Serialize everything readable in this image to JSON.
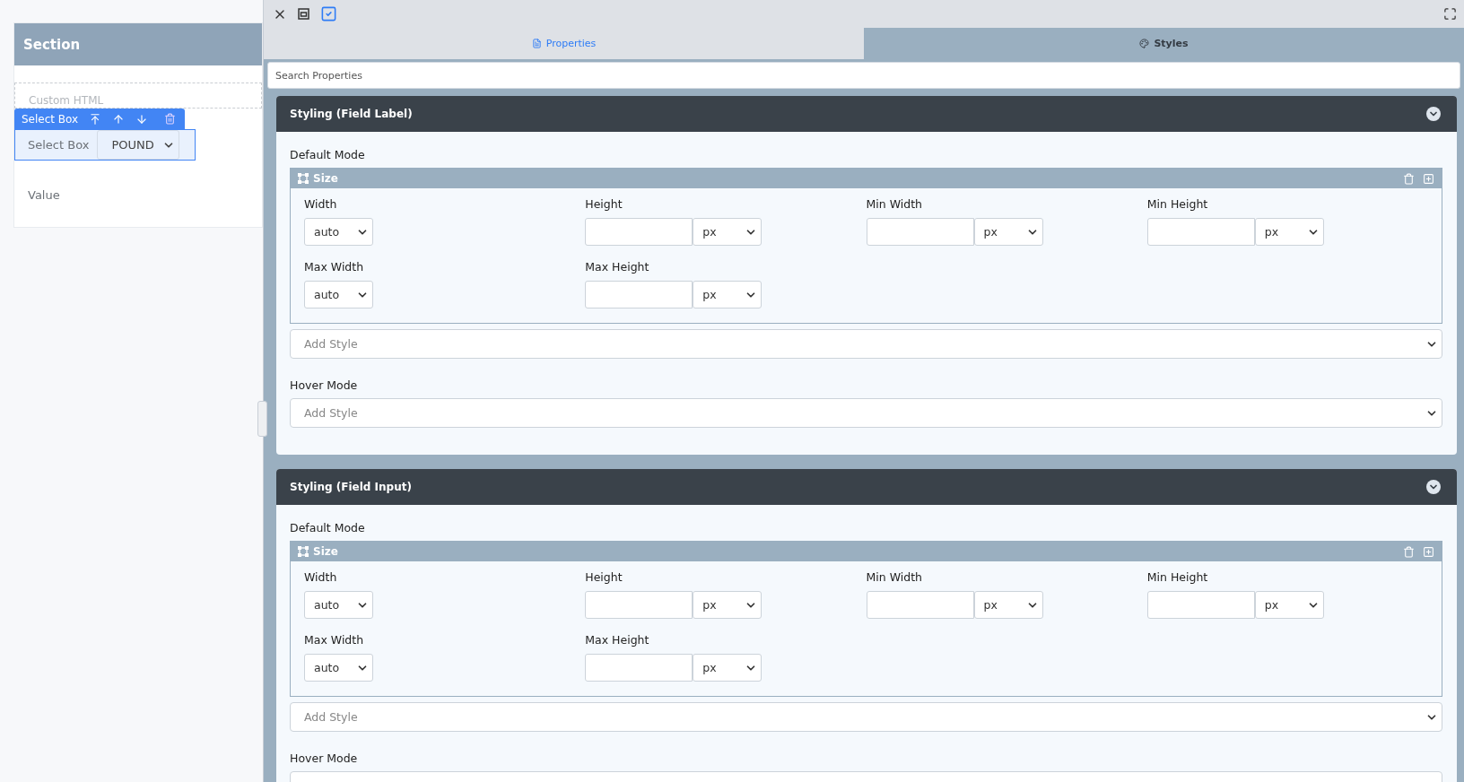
{
  "canvas": {
    "section_title": "Section",
    "custom_html_label": "Custom HTML",
    "toolbar": {
      "label": "Select Box"
    },
    "field": {
      "label": "Select Box",
      "value": "POUND"
    },
    "value_label": "Value"
  },
  "panel": {
    "tabs": [
      {
        "label": "Properties",
        "selected": false,
        "kind": "document"
      },
      {
        "label": "Styles",
        "selected": true,
        "kind": "palette"
      }
    ],
    "search": {
      "placeholder": "Search Properties"
    },
    "sections": [
      {
        "title": "Styling (Field Label)",
        "default_mode_label": "Default Mode",
        "group": {
          "title": "Size",
          "fields": [
            {
              "label": "Width",
              "kind": "select",
              "value": "auto"
            },
            {
              "label": "Height",
              "kind": "unit",
              "unit": "px"
            },
            {
              "label": "Min Width",
              "kind": "unit",
              "unit": "px"
            },
            {
              "label": "Min Height",
              "kind": "unit",
              "unit": "px"
            },
            {
              "label": "Max Width",
              "kind": "select",
              "value": "auto"
            },
            {
              "label": "Max Height",
              "kind": "unit",
              "unit": "px"
            }
          ]
        },
        "add_style_placeholder": "Add Style",
        "hover_mode_label": "Hover Mode",
        "hover_placeholder": "Add Style"
      },
      {
        "title": "Styling (Field Input)",
        "default_mode_label": "Default Mode",
        "group": {
          "title": "Size",
          "fields": [
            {
              "label": "Width",
              "kind": "select",
              "value": "auto"
            },
            {
              "label": "Height",
              "kind": "unit",
              "unit": "px"
            },
            {
              "label": "Min Width",
              "kind": "unit",
              "unit": "px"
            },
            {
              "label": "Min Height",
              "kind": "unit",
              "unit": "px"
            },
            {
              "label": "Max Width",
              "kind": "select",
              "value": "auto"
            },
            {
              "label": "Max Height",
              "kind": "unit",
              "unit": "px"
            }
          ]
        },
        "add_style_placeholder": "Add Style",
        "hover_mode_label": "Hover Mode"
      }
    ]
  }
}
